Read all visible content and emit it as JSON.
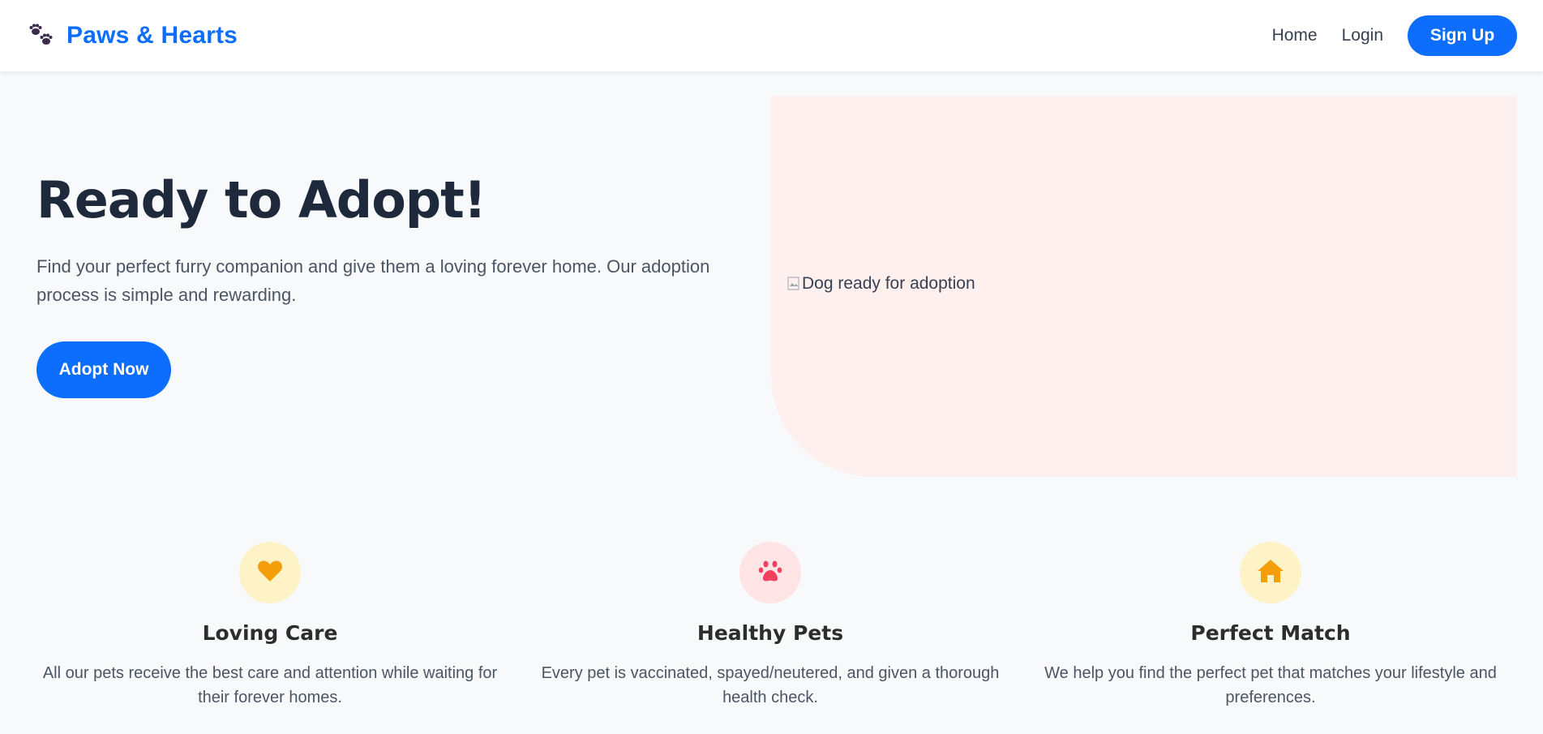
{
  "navbar": {
    "brand_icon": "paw-prints-icon",
    "brand_title": "Paws & Hearts",
    "links": [
      "Home",
      "Login"
    ],
    "signup_label": "Sign Up"
  },
  "hero": {
    "title": "Ready to Adopt!",
    "text": "Find your perfect furry companion and give them a loving forever home. Our adoption process is simple and rewarding.",
    "button_label": "Adopt Now",
    "image_alt": "Dog ready for adoption"
  },
  "features": [
    {
      "icon": "heart-icon",
      "icon_color": "#f59e0b",
      "icon_bg": "#fef3c7",
      "title": "Loving Care",
      "text": "All our pets receive the best care and attention while waiting for their forever homes."
    },
    {
      "icon": "paw-icon",
      "icon_color": "#f43f5e",
      "icon_bg": "#ffe4e6",
      "title": "Healthy Pets",
      "text": "Every pet is vaccinated, spayed/neutered, and given a thorough health check."
    },
    {
      "icon": "home-icon",
      "icon_color": "#f59e0b",
      "icon_bg": "#fef3c7",
      "title": "Perfect Match",
      "text": "We help you find the perfect pet that matches your lifestyle and preferences."
    }
  ],
  "colors": {
    "primary": "#0d6efd",
    "hero_image_bg": "#fff0f0",
    "page_bg": "#f8f9fb"
  }
}
